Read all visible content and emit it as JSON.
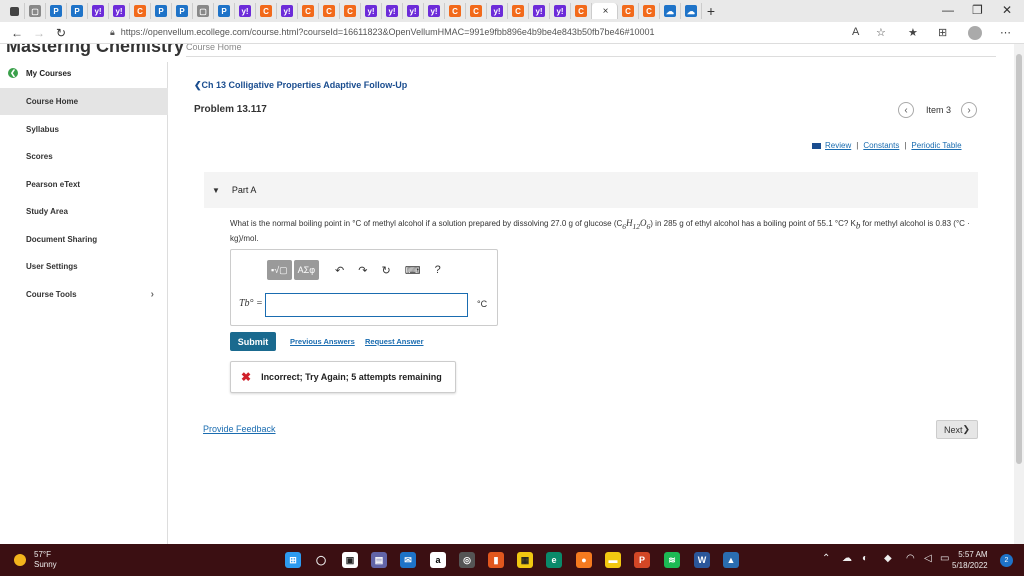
{
  "browser": {
    "tabs": [
      {
        "icon": "doc-icon",
        "color": "#888888",
        "glyph": "▢"
      },
      {
        "icon": "pearson-icon",
        "color": "#1e73c8",
        "glyph": "P"
      },
      {
        "icon": "pearson-icon",
        "color": "#1e73c8",
        "glyph": "P"
      },
      {
        "icon": "yahoo-icon",
        "color": "#6c2bd9",
        "glyph": "y!"
      },
      {
        "icon": "yahoo-icon",
        "color": "#6c2bd9",
        "glyph": "y!"
      },
      {
        "icon": "chegg-icon",
        "color": "#f26a1b",
        "glyph": "C"
      },
      {
        "icon": "pearson-icon",
        "color": "#1e73c8",
        "glyph": "P"
      },
      {
        "icon": "pearson-icon",
        "color": "#1e73c8",
        "glyph": "P"
      },
      {
        "icon": "doc-icon",
        "color": "#888888",
        "glyph": "▢"
      },
      {
        "icon": "pearson-icon",
        "color": "#1e73c8",
        "glyph": "P"
      },
      {
        "icon": "yahoo-icon",
        "color": "#6c2bd9",
        "glyph": "y!"
      },
      {
        "icon": "chegg-icon",
        "color": "#f26a1b",
        "glyph": "C"
      },
      {
        "icon": "yahoo-icon",
        "color": "#6c2bd9",
        "glyph": "y!"
      },
      {
        "icon": "chegg-icon",
        "color": "#f26a1b",
        "glyph": "C"
      },
      {
        "icon": "chegg-icon",
        "color": "#f26a1b",
        "glyph": "C"
      },
      {
        "icon": "chegg-icon",
        "color": "#f26a1b",
        "glyph": "C"
      },
      {
        "icon": "yahoo-icon",
        "color": "#6c2bd9",
        "glyph": "y!"
      },
      {
        "icon": "yahoo-icon",
        "color": "#6c2bd9",
        "glyph": "y!"
      },
      {
        "icon": "yahoo-icon",
        "color": "#6c2bd9",
        "glyph": "y!"
      },
      {
        "icon": "yahoo-icon",
        "color": "#6c2bd9",
        "glyph": "y!"
      },
      {
        "icon": "chegg-icon",
        "color": "#f26a1b",
        "glyph": "C"
      },
      {
        "icon": "chegg-icon",
        "color": "#f26a1b",
        "glyph": "C"
      },
      {
        "icon": "yahoo-icon",
        "color": "#6c2bd9",
        "glyph": "y!"
      },
      {
        "icon": "chegg-icon",
        "color": "#f26a1b",
        "glyph": "C"
      },
      {
        "icon": "yahoo-icon",
        "color": "#6c2bd9",
        "glyph": "y!"
      },
      {
        "icon": "yahoo-icon",
        "color": "#6c2bd9",
        "glyph": "y!"
      },
      {
        "icon": "chegg-icon",
        "color": "#f26a1b",
        "glyph": "C"
      }
    ],
    "active_tab_close": "×",
    "extra_tabs": [
      {
        "icon": "chegg-icon",
        "color": "#f26a1b",
        "glyph": "C"
      },
      {
        "icon": "chegg-icon",
        "color": "#f26a1b",
        "glyph": "C"
      },
      {
        "icon": "cloud-icon",
        "color": "#1e73c8",
        "glyph": "☁"
      },
      {
        "icon": "cloud-icon",
        "color": "#1e73c8",
        "glyph": "☁"
      }
    ],
    "new_tab": "+",
    "url": "https://openvellum.ecollege.com/course.html?courseId=16611823&OpenVellumHMAC=991e9fbb896e4b9be4e843b50fb7be46#10001"
  },
  "page": {
    "brand": "Mastering Chemistry",
    "course_home_top": "Course Home",
    "sidebar": {
      "my_courses": "My Courses",
      "items": [
        {
          "label": "Course Home",
          "active": true
        },
        {
          "label": "Syllabus"
        },
        {
          "label": "Scores"
        },
        {
          "label": "Pearson eText"
        },
        {
          "label": "Study Area"
        },
        {
          "label": "Document Sharing"
        },
        {
          "label": "User Settings"
        },
        {
          "label": "Course Tools",
          "chevron": "›"
        }
      ]
    },
    "back_link": "Ch 13 Colligative Properties Adaptive Follow-Up",
    "problem_title": "Problem 13.117",
    "item_label": "Item 3",
    "resource_links": [
      "Review",
      "Constants",
      "Periodic Table"
    ],
    "part_label": "Part A",
    "question_pre": "What is the normal boiling point in °C of methyl alcohol if a solution prepared by dissolving 27.0 g of glucose (C",
    "question_mid": ") in 285 g of ethyl alcohol has a boiling point of 55.1 °C? K",
    "question_post": " for methyl alcohol is 0.83 (°C · kg)/mol.",
    "answer_label": "Tb° =",
    "answer_unit": "°C",
    "submit_label": "Submit",
    "previous_answers": "Previous Answers",
    "request_answer": "Request Answer",
    "feedback_text": "Incorrect; Try Again; 5 attempts remaining",
    "provide_feedback": "Provide Feedback",
    "next_label": "Next"
  },
  "taskbar": {
    "temp": "57°F",
    "condition": "Sunny",
    "time": "5:57 AM",
    "date": "5/18/2022",
    "notif_count": "2"
  }
}
